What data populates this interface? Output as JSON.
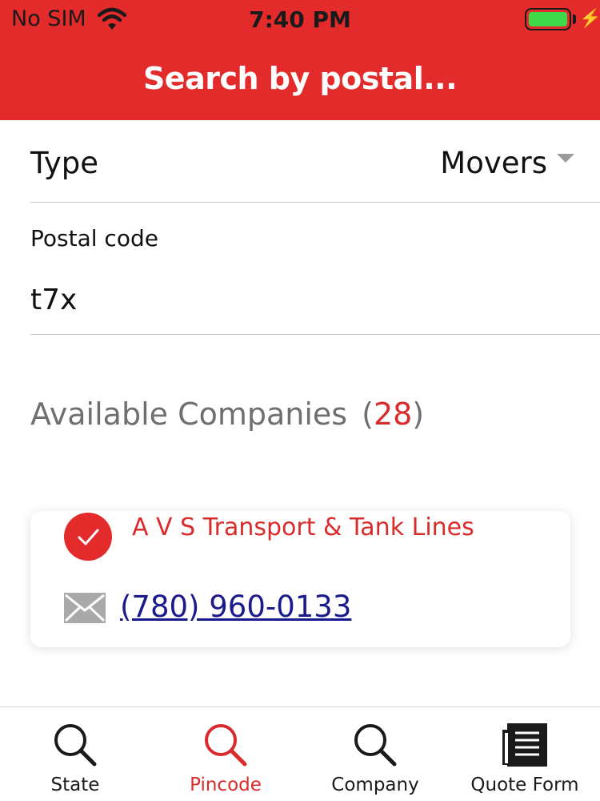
{
  "status_bar": {
    "carrier": "No SIM",
    "time": "7:40 PM",
    "battery_level": 1.0,
    "battery_color": "#3ed94a"
  },
  "header": {
    "title": "Search by postal...",
    "background_color": "#e42b2b"
  },
  "form": {
    "type_label": "Type",
    "type_value": "Movers",
    "postal_label": "Postal code",
    "postal_value": "t7x"
  },
  "results": {
    "heading": "Available Companies",
    "count_open": "(",
    "count": "28",
    "count_close": ")",
    "count_color": "#d92b2b"
  },
  "company_card": {
    "name": "A V S Transport & Tank Lines",
    "phone": "(780) 960-0133",
    "icons": [
      "checkmark-icon",
      "mail-icon"
    ]
  },
  "tabbar": {
    "tabs": [
      {
        "label": "State",
        "icon": "search-icon",
        "active": false
      },
      {
        "label": "Pincode",
        "icon": "search-icon",
        "active": true
      },
      {
        "label": "Company",
        "icon": "search-icon",
        "active": false
      },
      {
        "label": "Quote Form",
        "icon": "document-icon",
        "active": false
      }
    ],
    "active_color": "#d92b2b"
  }
}
